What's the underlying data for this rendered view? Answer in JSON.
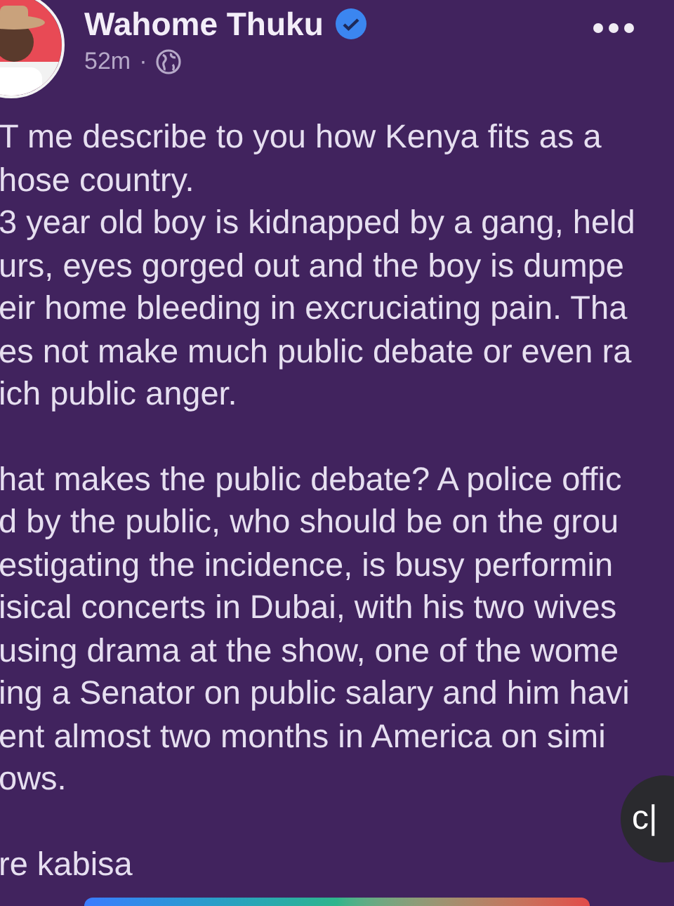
{
  "post": {
    "author": "Wahome Thuku",
    "verified": true,
    "time": "52m",
    "separator": "·",
    "paragraphs": [
      [
        "T me describe to you how Kenya fits as a",
        "hose country.",
        "3 year old boy is kidnapped by a gang, held",
        "urs, eyes gorged out and the boy is dumpe",
        "eir home bleeding in excruciating pain. Tha",
        "es not make much public debate or even ra",
        "ich public anger."
      ],
      [
        "hat makes the public debate? A police offic",
        "d by the public, who should be on the grou",
        "estigating the incidence, is busy performin",
        "isical concerts in Dubai, with his two wives",
        "using drama at the show, one of the wome",
        "ing a Senator on public salary and him havi",
        "ent almost two months in America on simi",
        "ows."
      ],
      [
        "re kabisa"
      ]
    ]
  },
  "floating_button": {
    "label": "c|"
  }
}
